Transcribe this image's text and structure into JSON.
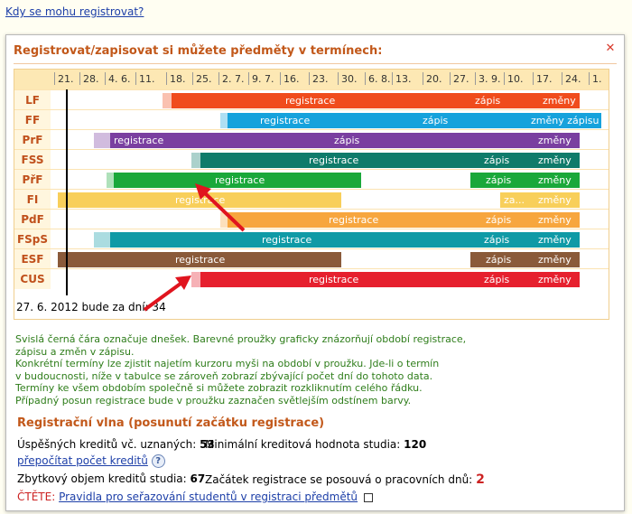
{
  "top_link": "Kdy se mohu registrovat?",
  "popup": {
    "title": "Registrovat/zapisovat si můžete předměty v termínech:",
    "close_icon": "close-icon"
  },
  "axis_ticks": [
    "21.",
    "28.",
    "4. 6.",
    "11.",
    "18.",
    "25.",
    "2. 7.",
    "9. 7.",
    "16.",
    "23.",
    "30.",
    "6. 8.",
    "13.",
    "20.",
    "27.",
    "3. 9.",
    "10.",
    "17.",
    "24.",
    "1."
  ],
  "rows": [
    {
      "label": "LF",
      "bars": [
        {
          "text": "registrace",
          "color": "#f04c1c"
        },
        {
          "text": "zápis",
          "color": "#f04c1c"
        },
        {
          "text": "změny",
          "color": "#f04c1c"
        }
      ]
    },
    {
      "label": "FF",
      "bars": [
        {
          "text": "registrace",
          "color": "#16a2dc"
        },
        {
          "text": "zápis",
          "color": "#16a2dc"
        },
        {
          "text": "změny zápisu",
          "color": "#16a2dc"
        }
      ]
    },
    {
      "label": "PrF",
      "bars": [
        {
          "text": "registrace",
          "color": "#7a3fa0"
        },
        {
          "text": "zápis",
          "color": "#7a3fa0"
        },
        {
          "text": "změny",
          "color": "#7a3fa0"
        }
      ]
    },
    {
      "label": "FSS",
      "bars": [
        {
          "text": "registrace",
          "color": "#0f7b6a"
        },
        {
          "text": "zápis",
          "color": "#0f7b6a"
        },
        {
          "text": "změny",
          "color": "#0f7b6a"
        }
      ]
    },
    {
      "label": "PřF",
      "bars": [
        {
          "text": "registrace",
          "color": "#1aa83a"
        },
        {
          "text": "zápis",
          "color": "#1aa83a"
        },
        {
          "text": "změny",
          "color": "#1aa83a"
        }
      ]
    },
    {
      "label": "FI",
      "bars": [
        {
          "text": "registrace",
          "color": "#f8cf5a"
        },
        {
          "text": "za...",
          "color": "#f8cf5a"
        },
        {
          "text": "změny",
          "color": "#f8cf5a"
        }
      ]
    },
    {
      "label": "PdF",
      "bars": [
        {
          "text": "registrace",
          "color": "#f7a63e"
        },
        {
          "text": "zápis",
          "color": "#f7a63e"
        },
        {
          "text": "změny",
          "color": "#f7a63e"
        }
      ]
    },
    {
      "label": "FSpS",
      "bars": [
        {
          "text": "registrace",
          "color": "#0f9aa6"
        },
        {
          "text": "zápis",
          "color": "#0f9aa6"
        },
        {
          "text": "změny",
          "color": "#0f9aa6"
        }
      ]
    },
    {
      "label": "ESF",
      "bars": [
        {
          "text": "registrace",
          "color": "#8a5a3a"
        },
        {
          "text": "zápis",
          "color": "#8a5a3a"
        },
        {
          "text": "změny",
          "color": "#8a5a3a"
        }
      ]
    },
    {
      "label": "CUS",
      "bars": [
        {
          "text": "registrace",
          "color": "#e6202e"
        },
        {
          "text": "zápis",
          "color": "#e6202e"
        },
        {
          "text": "změny",
          "color": "#e6202e"
        }
      ]
    }
  ],
  "days_line": "27. 6. 2012 bude za dní: 34",
  "help_lines": [
    "Svislá černá čára označuje dnešek. Barevné proužky graficky znázorňují období registrace,",
    "zápisu a změn v zápisu.",
    "Konkrétní termíny lze zjistit najetím kurzoru myši na období v proužku. Jde-li o termín",
    "v budoucnosti, níže v tabulce se zároveň zobrazí zbývající počet dní do tohoto data.",
    "Termíny ke všem obdobím společně si můžete zobrazit rozkliknutím celého řádku.",
    "Případný posun registrace bude v proužku zaznačen světlejším odstínem barvy."
  ],
  "wave": {
    "title": "Registrační vlna (posunutí začátku registrace)",
    "credits_label": "Úspěšných kreditů vč. uznaných:",
    "credits_value": "53",
    "min_label": "Minimální kreditová hodnota studia:",
    "min_value": "120",
    "recalc_link": "přepočítat počet kreditů",
    "remaining_label": "Zbytkový objem kreditů studia:",
    "remaining_value": "67",
    "shift_label": "Začátek registrace se posouvá o pracovních dnů:",
    "shift_value": "2",
    "read_label": "ČTĚTE:",
    "rules_link": "Pravidla pro seřazování studentů v registraci předmětů"
  }
}
